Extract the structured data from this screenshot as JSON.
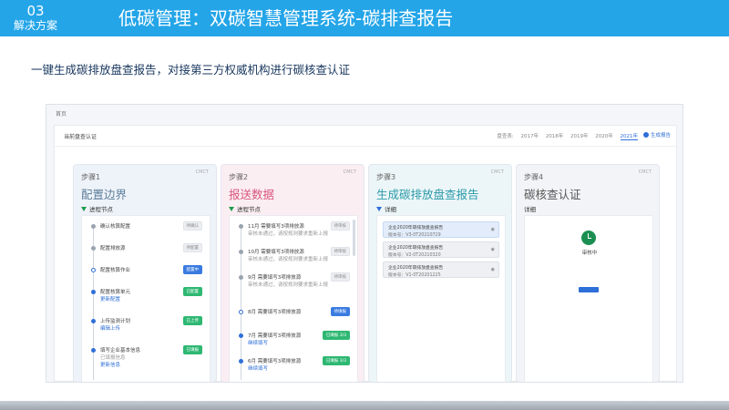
{
  "header": {
    "section_number": "03",
    "section_label": "解决方案",
    "title": "低碳管理：双碳智慧管理系统-碳排查报告"
  },
  "subtitle": "一键生成碳排放盘查报告，对接第三方权威机构进行碳核查认证",
  "screenshot": {
    "breadcrumb": "首页",
    "panel_title": "当前盘查认证",
    "year_label": "盘查表:",
    "years": [
      "2017年",
      "2018年",
      "2019年",
      "2020年",
      "2021年"
    ],
    "active_year_index": 4,
    "generate_link": "生成报告",
    "steps": [
      {
        "step": "步骤1",
        "badge": "CMCT",
        "title": "配置边界",
        "section": "进程节点",
        "items": [
          {
            "label": "确认核算配置",
            "tag": "待确认",
            "tag_style": "gray",
            "dot": "gray"
          },
          {
            "label": "配置排放源",
            "tag": "待配置",
            "tag_style": "gray",
            "dot": "gray"
          },
          {
            "label": "配置核算作业",
            "tag": "配置中",
            "tag_style": "blue",
            "dot": "ring"
          },
          {
            "label": "配置核算单元",
            "sub": "更新配置",
            "tag": "已配置",
            "tag_style": "green",
            "dot": "blue"
          },
          {
            "label": "上传监测计划",
            "sub": "编辑上传",
            "tag": "已上传",
            "tag_style": "green",
            "dot": "blue"
          },
          {
            "label": "填写企业基本信息",
            "sub": "已填报信息",
            "sub2": "更新信息",
            "tag": "已填报",
            "tag_style": "green",
            "dot": "blue"
          }
        ]
      },
      {
        "step": "步骤2",
        "badge": "CMCT",
        "title": "报送数据",
        "section": "进程节点",
        "items": [
          {
            "label": "11月 需要填写3项排放源",
            "sub": "审核未通过，请按规则要求重新上报",
            "tag": "待审核",
            "tag_style": "gray",
            "dot": "gray"
          },
          {
            "label": "10月 需要填写3项排放源",
            "sub": "审核未通过，请按规则要求重新上报",
            "tag": "待审核",
            "tag_style": "gray",
            "dot": "gray"
          },
          {
            "label": "9月 需要填写3项排放源",
            "sub": "审核未通过，请按规则要求重新上报",
            "tag": "待审核",
            "tag_style": "gray",
            "dot": "gray"
          },
          {
            "label": "8月 需要填写3项排放源",
            "tag": "待填报",
            "tag_style": "blue",
            "dot": "ring"
          },
          {
            "label": "7月 需要填写3项排放源",
            "sub": "继续填写",
            "tag": "已填报 3/3",
            "tag_style": "green",
            "dot": "blue"
          },
          {
            "label": "6月 需要填写3项排放源",
            "sub": "继续填写",
            "tag": "已填报 3/3",
            "tag_style": "green",
            "dot": "blue"
          }
        ]
      },
      {
        "step": "步骤3",
        "badge": "CMCT",
        "title": "生成碳排放盘查报告",
        "section": "详细",
        "reports": [
          {
            "name": "企业2020年碳排放盘查报告",
            "version": "版本号：V3-0T20210729"
          },
          {
            "name": "企业2020年碳排放盘查报告",
            "version": "版本号：V2-0T20210320"
          },
          {
            "name": "企业2020年碳排放盘查报告",
            "version": "版本号：V1-0T20201225"
          }
        ]
      },
      {
        "step": "步骤4",
        "badge": "CMCT",
        "title": "碳核查认证",
        "section": "详细",
        "status": "审核中"
      }
    ]
  },
  "colors": {
    "header_bar": "#24a5e8",
    "subtitle": "#17365d",
    "step1_title": "#5c7d99",
    "step2_title": "#d9547e",
    "step3_title": "#2a9aa8",
    "accent": "#2f6fd8",
    "success": "#2eb872"
  }
}
